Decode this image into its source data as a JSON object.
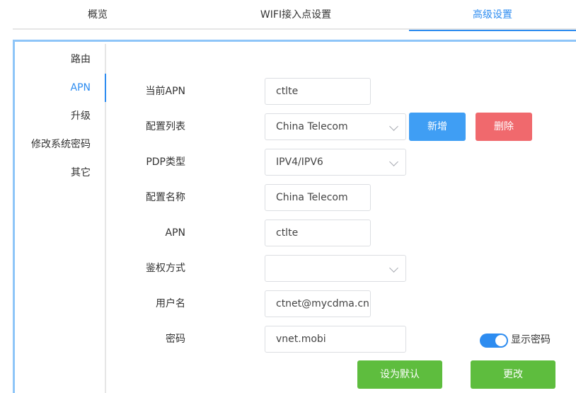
{
  "tabs": {
    "overview": "概览",
    "wifi": "WIFI接入点设置",
    "advanced": "高级设置"
  },
  "sidebar": {
    "items": [
      {
        "label": "路由"
      },
      {
        "label": "APN"
      },
      {
        "label": "升级"
      },
      {
        "label": "修改系统密码"
      },
      {
        "label": "其它"
      }
    ],
    "active": "APN"
  },
  "form": {
    "current_apn": {
      "label": "当前APN",
      "value": "ctlte"
    },
    "profile_list": {
      "label": "配置列表",
      "value": "China Telecom"
    },
    "pdp_type": {
      "label": "PDP类型",
      "value": "IPV4/IPV6"
    },
    "profile_name": {
      "label": "配置名称",
      "value": "China Telecom"
    },
    "apn": {
      "label": "APN",
      "value": "ctlte"
    },
    "auth_method": {
      "label": "鉴权方式",
      "value": ""
    },
    "username": {
      "label": "用户名",
      "value": "ctnet@mycdma.cn"
    },
    "password": {
      "label": "密码",
      "value": "vnet.mobi"
    }
  },
  "buttons": {
    "add": "新增",
    "delete": "删除",
    "set_default": "设为默认",
    "change": "更改"
  },
  "show_password": {
    "label": "显示密码",
    "enabled": true
  },
  "colors": {
    "accent": "#2d8cf0",
    "add_button": "#3f9ef4",
    "delete_button": "#f0696d",
    "primary_action": "#5ebd3e"
  }
}
